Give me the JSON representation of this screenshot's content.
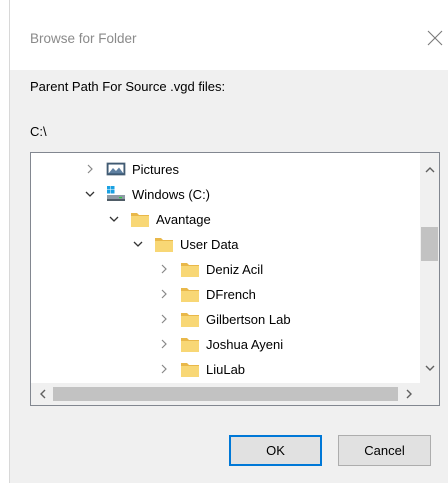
{
  "dialog": {
    "title": "Browse for Folder",
    "prompt": "Parent Path For Source .vgd files:",
    "current_path": "C:\\"
  },
  "tree": {
    "items": [
      {
        "label": "Pictures",
        "icon": "pictures-library-icon",
        "expander": "collapsed"
      },
      {
        "label": "Windows (C:)",
        "icon": "drive-icon",
        "expander": "expanded"
      },
      {
        "label": "Avantage",
        "icon": "folder-icon",
        "expander": "expanded"
      },
      {
        "label": "User Data",
        "icon": "folder-icon",
        "expander": "expanded"
      },
      {
        "label": "Deniz Acil",
        "icon": "folder-icon",
        "expander": "collapsed"
      },
      {
        "label": "DFrench",
        "icon": "folder-icon",
        "expander": "collapsed"
      },
      {
        "label": "Gilbertson Lab",
        "icon": "folder-icon",
        "expander": "collapsed"
      },
      {
        "label": "Joshua Ayeni",
        "icon": "folder-icon",
        "expander": "collapsed"
      },
      {
        "label": "LiuLab",
        "icon": "folder-icon",
        "expander": "collapsed"
      }
    ]
  },
  "buttons": {
    "ok_label": "OK",
    "cancel_label": "Cancel"
  },
  "colors": {
    "folder": "#f8d775",
    "accent": "#0078d7",
    "title_text": "#8a8a8a"
  }
}
